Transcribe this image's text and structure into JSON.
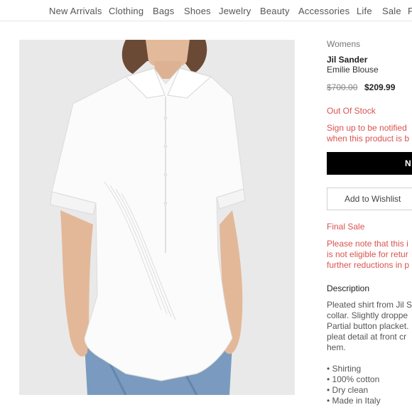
{
  "nav": {
    "items": [
      "New Arrivals",
      "Clothing",
      "Bags",
      "Shoes",
      "Jewelry",
      "Beauty",
      "Accessories",
      "Life",
      "Sale",
      "F"
    ]
  },
  "product": {
    "department": "Womens",
    "brand": "Jil Sander",
    "name": "Emilie Blouse",
    "original_price": "$700.00",
    "sale_price": "$209.99",
    "stock_status": "Out Of Stock",
    "notify_text": [
      "Sign up to be notified",
      "when this product is b"
    ],
    "notify_button": "N",
    "wishlist_button": "Add to Wishlist",
    "final_sale_label": "Final Sale",
    "final_sale_note": [
      "Please note that this i",
      "is not eligible for retur",
      "further reductions in p"
    ],
    "description_heading": "Description",
    "description": [
      "Pleated shirt from Jil S",
      "collar. Slightly droppe",
      "Partial button placket.",
      "pleat detail at front cr",
      "hem."
    ],
    "bullets": [
      "• Shirting",
      "• 100% cotton",
      "• Dry clean",
      "• Made in Italy"
    ]
  },
  "colors": {
    "alert_red": "#d9534f",
    "button_black": "#000000",
    "photo_bg": "#e9e9e9"
  }
}
